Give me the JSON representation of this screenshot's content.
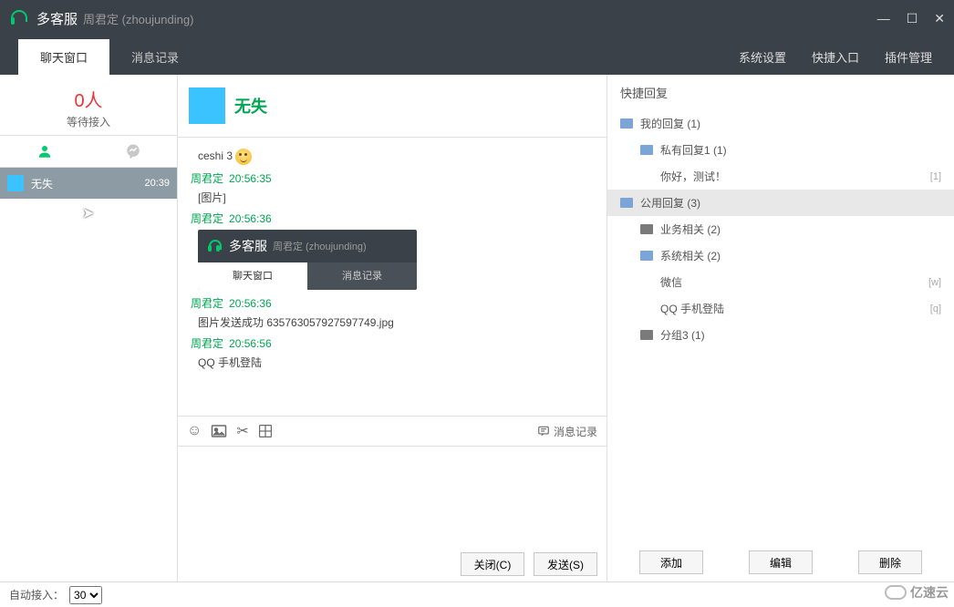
{
  "titlebar": {
    "app_name": "多客服",
    "user_display": "周君定 (zhoujunding)"
  },
  "top_tabs": {
    "chat": "聊天窗口",
    "history": "消息记录"
  },
  "top_menu": {
    "settings": "系统设置",
    "shortcuts": "快捷入口",
    "plugins": "插件管理"
  },
  "waiting": {
    "count": "0人",
    "label": "等待接入"
  },
  "session": {
    "name": "无失",
    "time": "20:39"
  },
  "chat": {
    "contact_name": "无失",
    "messages": {
      "m0_text": "ceshi 3",
      "m1_user": "周君定",
      "m1_time": "20:56:35",
      "m1_text": "[图片]",
      "m2_user": "周君定",
      "m2_time": "20:56:36",
      "mb_title": "多客服",
      "mb_user": "周君定 (zhoujunding)",
      "mb_tab1": "聊天窗口",
      "mb_tab2": "消息记录",
      "m3_user": "周君定",
      "m3_time": "20:56:36",
      "m3_text": "图片发送成功 635763057927597749.jpg",
      "m4_user": "周君定",
      "m4_time": "20:56:56",
      "m4_text": "QQ 手机登陆"
    },
    "history_link": "消息记录",
    "close_btn": "关闭(C)",
    "send_btn": "发送(S)"
  },
  "quick": {
    "title": "快捷回复",
    "tree": {
      "my_replies": "我的回复 (1)",
      "private1": "私有回复1 (1)",
      "hello_test": "你好，测试！",
      "hello_key": "[1]",
      "public": "公用回复 (3)",
      "biz": "业务相关 (2)",
      "sys": "系统相关 (2)",
      "wechat": "微信",
      "wechat_key": "[w]",
      "qq": "QQ 手机登陆",
      "qq_key": "[q]",
      "group3": "分组3 (1)"
    },
    "add": "添加",
    "edit": "编辑",
    "del": "删除"
  },
  "status": {
    "auto_label": "自动接入：",
    "auto_value": "30"
  },
  "watermark": "亿速云"
}
